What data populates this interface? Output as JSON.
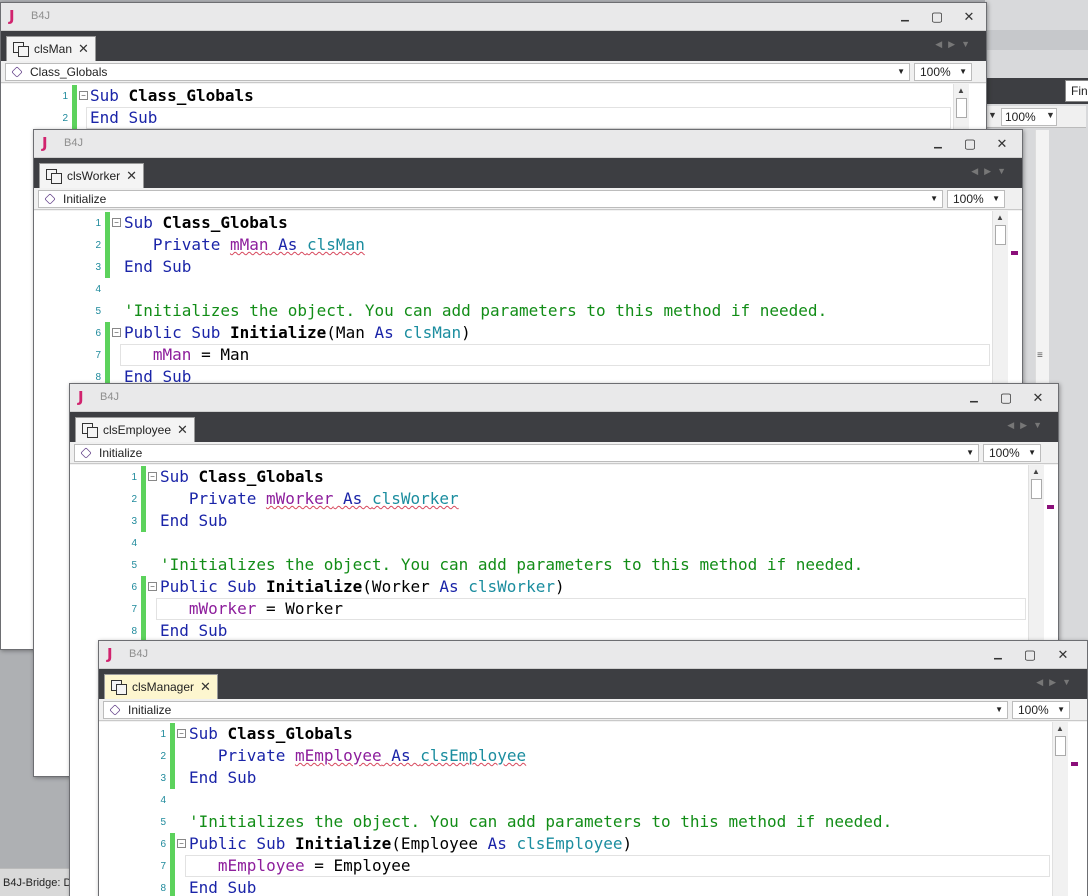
{
  "background": {
    "find_label": "Fin",
    "zoom": "100%",
    "status_text": "B4J-Bridge: D"
  },
  "windows": [
    {
      "id": "w1",
      "app_title": "B4J",
      "tab_label": "clsMan",
      "sub_selector": "Class_Globals",
      "zoom": "100%",
      "lines": [
        {
          "num": "1",
          "tokens": [
            [
              "kw",
              "Sub "
            ],
            [
              "bold",
              "Class_Globals"
            ]
          ]
        },
        {
          "num": "2",
          "tokens": [
            [
              "kw",
              "End Sub"
            ]
          ]
        }
      ]
    },
    {
      "id": "w2",
      "app_title": "B4J",
      "tab_label": "clsWorker",
      "sub_selector": "Initialize",
      "zoom": "100%",
      "lines": [
        {
          "num": "1",
          "tokens": [
            [
              "kw",
              "Sub "
            ],
            [
              "bold",
              "Class_Globals"
            ]
          ]
        },
        {
          "num": "2",
          "tokens": [
            [
              "kw",
              "   Private "
            ],
            [
              "var sq",
              "mMan"
            ],
            [
              "kw sq",
              " As "
            ],
            [
              "cls sq",
              "clsMan"
            ]
          ]
        },
        {
          "num": "3",
          "tokens": [
            [
              "kw",
              "End Sub"
            ]
          ]
        },
        {
          "num": "4",
          "tokens": []
        },
        {
          "num": "5",
          "tokens": [
            [
              "cmt",
              "'Initializes the object. You can add parameters to this method if needed."
            ]
          ]
        },
        {
          "num": "6",
          "tokens": [
            [
              "kw",
              "Public Sub "
            ],
            [
              "bold",
              "Initialize"
            ],
            [
              "",
              "(Man "
            ],
            [
              "kw",
              "As "
            ],
            [
              "cls",
              "clsMan"
            ],
            [
              "",
              ")"
            ]
          ]
        },
        {
          "num": "7",
          "tokens": [
            [
              "var",
              "   mMan"
            ],
            [
              "",
              " = Man"
            ]
          ]
        },
        {
          "num": "8",
          "tokens": [
            [
              "kw",
              "End Sub"
            ]
          ]
        }
      ]
    },
    {
      "id": "w3",
      "app_title": "B4J",
      "tab_label": "clsEmployee",
      "sub_selector": "Initialize",
      "zoom": "100%",
      "lines": [
        {
          "num": "1",
          "tokens": [
            [
              "kw",
              "Sub "
            ],
            [
              "bold",
              "Class_Globals"
            ]
          ]
        },
        {
          "num": "2",
          "tokens": [
            [
              "kw",
              "   Private "
            ],
            [
              "var sq",
              "mWorker"
            ],
            [
              "kw sq",
              " As "
            ],
            [
              "cls sq",
              "clsWorker"
            ]
          ]
        },
        {
          "num": "3",
          "tokens": [
            [
              "kw",
              "End Sub"
            ]
          ]
        },
        {
          "num": "4",
          "tokens": []
        },
        {
          "num": "5",
          "tokens": [
            [
              "cmt",
              "'Initializes the object. You can add parameters to this method if needed."
            ]
          ]
        },
        {
          "num": "6",
          "tokens": [
            [
              "kw",
              "Public Sub "
            ],
            [
              "bold",
              "Initialize"
            ],
            [
              "",
              "(Worker "
            ],
            [
              "kw",
              "As "
            ],
            [
              "cls",
              "clsWorker"
            ],
            [
              "",
              ")"
            ]
          ]
        },
        {
          "num": "7",
          "tokens": [
            [
              "var",
              "   mWorker"
            ],
            [
              "",
              " = Worker"
            ]
          ]
        },
        {
          "num": "8",
          "tokens": [
            [
              "kw",
              "End Sub"
            ]
          ]
        }
      ]
    },
    {
      "id": "w4",
      "app_title": "B4J",
      "tab_label": "clsManager",
      "sub_selector": "Initialize",
      "zoom": "100%",
      "lines": [
        {
          "num": "1",
          "tokens": [
            [
              "kw",
              "Sub "
            ],
            [
              "bold",
              "Class_Globals"
            ]
          ]
        },
        {
          "num": "2",
          "tokens": [
            [
              "kw",
              "   Private "
            ],
            [
              "var sq",
              "mEmployee"
            ],
            [
              "kw sq",
              " As "
            ],
            [
              "cls sq",
              "clsEmployee"
            ]
          ]
        },
        {
          "num": "3",
          "tokens": [
            [
              "kw",
              "End Sub"
            ]
          ]
        },
        {
          "num": "4",
          "tokens": []
        },
        {
          "num": "5",
          "tokens": [
            [
              "cmt",
              "'Initializes the object. You can add parameters to this method if needed."
            ]
          ]
        },
        {
          "num": "6",
          "tokens": [
            [
              "kw",
              "Public Sub "
            ],
            [
              "bold",
              "Initialize"
            ],
            [
              "",
              "(Employee "
            ],
            [
              "kw",
              "As "
            ],
            [
              "cls",
              "clsEmployee"
            ],
            [
              "",
              ")"
            ]
          ]
        },
        {
          "num": "7",
          "tokens": [
            [
              "var",
              "   mEmployee"
            ],
            [
              "",
              " = Employee"
            ]
          ]
        },
        {
          "num": "8",
          "tokens": [
            [
              "kw",
              "End Sub"
            ]
          ]
        }
      ]
    }
  ]
}
